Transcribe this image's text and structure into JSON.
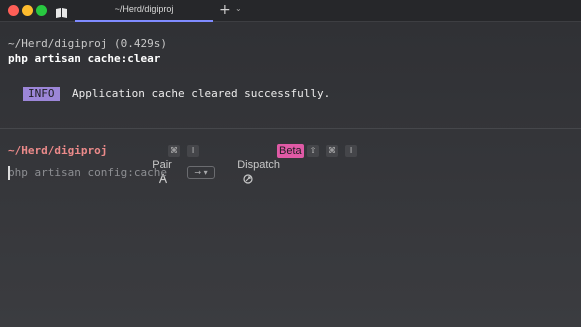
{
  "window": {
    "traffic_lights": {
      "close_color": "#ff5f57",
      "minimize_color": "#febc2e",
      "maximize_color": "#28c840"
    },
    "sidebar_icon": "book-icon",
    "tab": {
      "title": "~/Herd/digiproj"
    },
    "new_tab_label": "+",
    "tab_menu_label": "⌄"
  },
  "output": {
    "prev_block": {
      "path_and_time": "~/Herd/digiproj (0.429s)",
      "command": "php artisan cache:clear",
      "badge": "INFO",
      "message": "Application cache cleared successfully."
    }
  },
  "prompt": {
    "path": "~/Herd/digiproj",
    "pair": {
      "icon": "pair-icon",
      "label": "Pair",
      "shortcut_keys": [
        "⌘",
        "I"
      ]
    },
    "dispatch": {
      "icon": "dispatch-icon",
      "label": "Dispatch",
      "badge": "Beta",
      "shortcut_keys": [
        "⇧",
        "⌘",
        "I"
      ]
    },
    "input": {
      "suggestion": "php artisan config:cache",
      "accept_hint": "→ ▾"
    }
  },
  "colors": {
    "accent": "#7f8bff",
    "info_badge": "#9c86d8",
    "prompt_path": "#eb8a8a",
    "beta_badge": "#e05aa6"
  }
}
